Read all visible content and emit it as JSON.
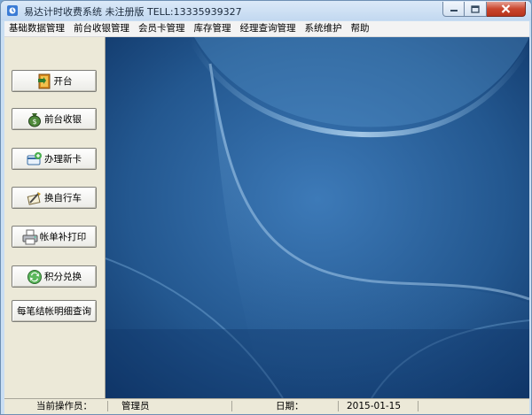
{
  "window": {
    "title": "易达计时收费系统 未注册版 TELL:13335939327"
  },
  "menu": [
    {
      "label": "基础数据管理"
    },
    {
      "label": "前台收银管理"
    },
    {
      "label": "会员卡管理"
    },
    {
      "label": "库存管理"
    },
    {
      "label": "经理查询管理"
    },
    {
      "label": "系统维护"
    },
    {
      "label": "帮助"
    }
  ],
  "sidebar": [
    {
      "label": "开台",
      "icon": "door-icon"
    },
    {
      "label": "前台收银",
      "icon": "money-bag-icon"
    },
    {
      "label": "办理新卡",
      "icon": "new-card-icon"
    },
    {
      "label": "换自行车",
      "icon": "swap-bicycle-icon"
    },
    {
      "label": "帐单补打印",
      "icon": "printer-icon"
    },
    {
      "label": "积分兑换",
      "icon": "points-exchange-icon"
    },
    {
      "label": "每笔结帐明细查询",
      "icon": ""
    }
  ],
  "status": {
    "operator_label": "当前操作员：",
    "operator_value": "管理员",
    "date_label": "日期：",
    "date_value": "2015-01-15"
  },
  "colors": {
    "accent_blue": "#1f5797",
    "close_red": "#c9462e"
  }
}
